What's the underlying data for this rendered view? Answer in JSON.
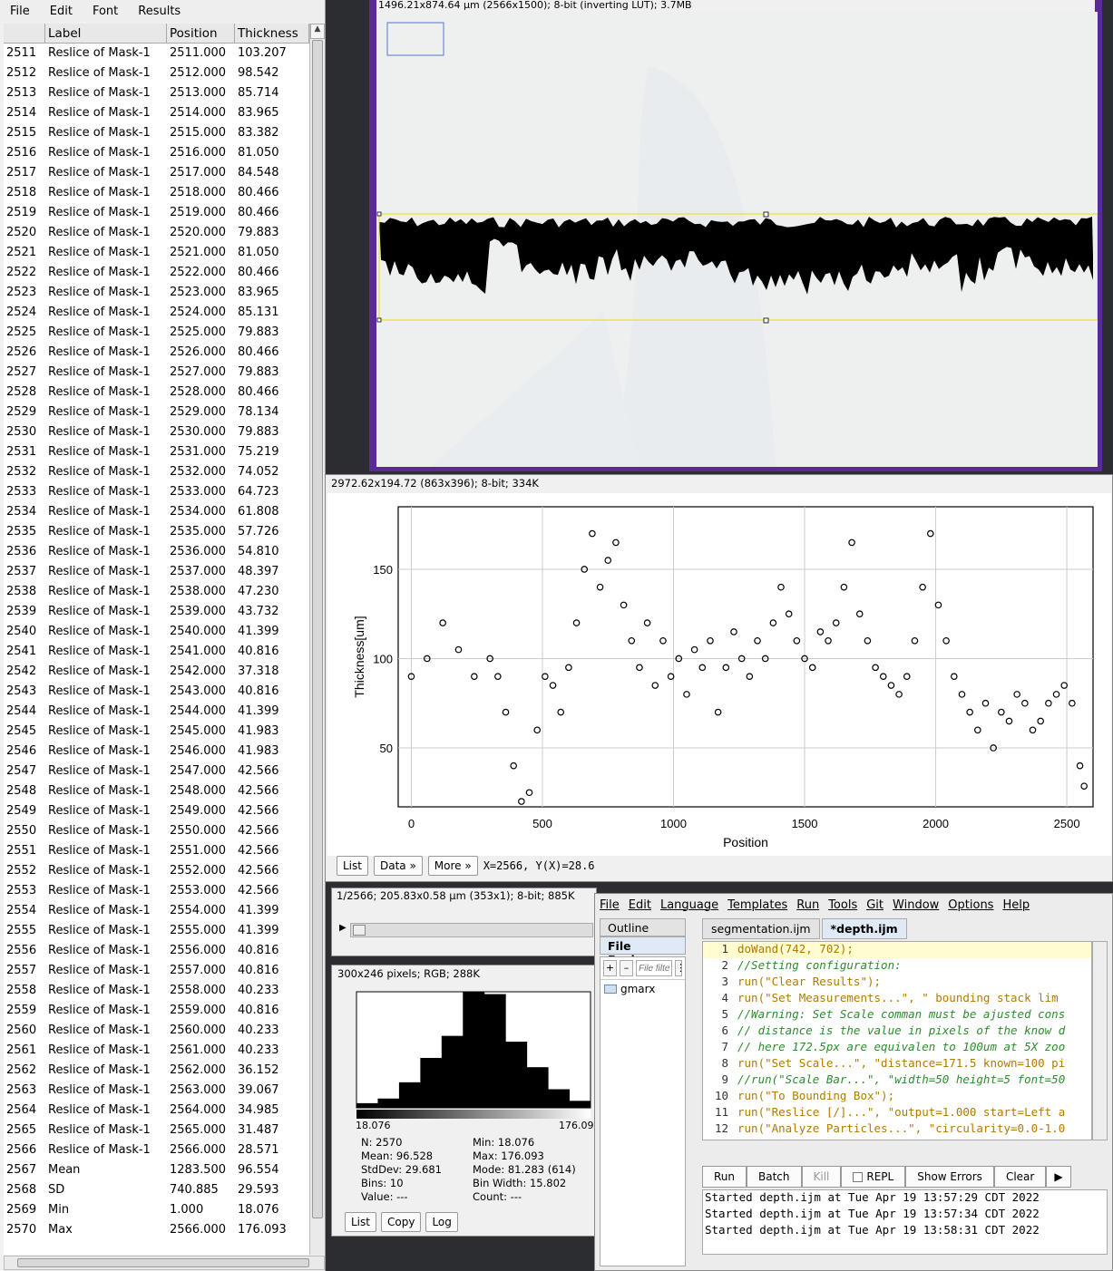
{
  "results": {
    "menu": [
      "File",
      "Edit",
      "Font",
      "Results"
    ],
    "columns": [
      "",
      "Label",
      "Position",
      "Thickness"
    ],
    "rows": [
      [
        "2511",
        "Reslice of Mask-1",
        "2511.000",
        "103.207"
      ],
      [
        "2512",
        "Reslice of Mask-1",
        "2512.000",
        "98.542"
      ],
      [
        "2513",
        "Reslice of Mask-1",
        "2513.000",
        "85.714"
      ],
      [
        "2514",
        "Reslice of Mask-1",
        "2514.000",
        "83.965"
      ],
      [
        "2515",
        "Reslice of Mask-1",
        "2515.000",
        "83.382"
      ],
      [
        "2516",
        "Reslice of Mask-1",
        "2516.000",
        "81.050"
      ],
      [
        "2517",
        "Reslice of Mask-1",
        "2517.000",
        "84.548"
      ],
      [
        "2518",
        "Reslice of Mask-1",
        "2518.000",
        "80.466"
      ],
      [
        "2519",
        "Reslice of Mask-1",
        "2519.000",
        "80.466"
      ],
      [
        "2520",
        "Reslice of Mask-1",
        "2520.000",
        "79.883"
      ],
      [
        "2521",
        "Reslice of Mask-1",
        "2521.000",
        "81.050"
      ],
      [
        "2522",
        "Reslice of Mask-1",
        "2522.000",
        "80.466"
      ],
      [
        "2523",
        "Reslice of Mask-1",
        "2523.000",
        "83.965"
      ],
      [
        "2524",
        "Reslice of Mask-1",
        "2524.000",
        "85.131"
      ],
      [
        "2525",
        "Reslice of Mask-1",
        "2525.000",
        "79.883"
      ],
      [
        "2526",
        "Reslice of Mask-1",
        "2526.000",
        "80.466"
      ],
      [
        "2527",
        "Reslice of Mask-1",
        "2527.000",
        "79.883"
      ],
      [
        "2528",
        "Reslice of Mask-1",
        "2528.000",
        "80.466"
      ],
      [
        "2529",
        "Reslice of Mask-1",
        "2529.000",
        "78.134"
      ],
      [
        "2530",
        "Reslice of Mask-1",
        "2530.000",
        "79.883"
      ],
      [
        "2531",
        "Reslice of Mask-1",
        "2531.000",
        "75.219"
      ],
      [
        "2532",
        "Reslice of Mask-1",
        "2532.000",
        "74.052"
      ],
      [
        "2533",
        "Reslice of Mask-1",
        "2533.000",
        "64.723"
      ],
      [
        "2534",
        "Reslice of Mask-1",
        "2534.000",
        "61.808"
      ],
      [
        "2535",
        "Reslice of Mask-1",
        "2535.000",
        "57.726"
      ],
      [
        "2536",
        "Reslice of Mask-1",
        "2536.000",
        "54.810"
      ],
      [
        "2537",
        "Reslice of Mask-1",
        "2537.000",
        "48.397"
      ],
      [
        "2538",
        "Reslice of Mask-1",
        "2538.000",
        "47.230"
      ],
      [
        "2539",
        "Reslice of Mask-1",
        "2539.000",
        "43.732"
      ],
      [
        "2540",
        "Reslice of Mask-1",
        "2540.000",
        "41.399"
      ],
      [
        "2541",
        "Reslice of Mask-1",
        "2541.000",
        "40.816"
      ],
      [
        "2542",
        "Reslice of Mask-1",
        "2542.000",
        "37.318"
      ],
      [
        "2543",
        "Reslice of Mask-1",
        "2543.000",
        "40.816"
      ],
      [
        "2544",
        "Reslice of Mask-1",
        "2544.000",
        "41.399"
      ],
      [
        "2545",
        "Reslice of Mask-1",
        "2545.000",
        "41.983"
      ],
      [
        "2546",
        "Reslice of Mask-1",
        "2546.000",
        "41.983"
      ],
      [
        "2547",
        "Reslice of Mask-1",
        "2547.000",
        "42.566"
      ],
      [
        "2548",
        "Reslice of Mask-1",
        "2548.000",
        "42.566"
      ],
      [
        "2549",
        "Reslice of Mask-1",
        "2549.000",
        "42.566"
      ],
      [
        "2550",
        "Reslice of Mask-1",
        "2550.000",
        "42.566"
      ],
      [
        "2551",
        "Reslice of Mask-1",
        "2551.000",
        "42.566"
      ],
      [
        "2552",
        "Reslice of Mask-1",
        "2552.000",
        "42.566"
      ],
      [
        "2553",
        "Reslice of Mask-1",
        "2553.000",
        "42.566"
      ],
      [
        "2554",
        "Reslice of Mask-1",
        "2554.000",
        "41.399"
      ],
      [
        "2555",
        "Reslice of Mask-1",
        "2555.000",
        "41.399"
      ],
      [
        "2556",
        "Reslice of Mask-1",
        "2556.000",
        "40.816"
      ],
      [
        "2557",
        "Reslice of Mask-1",
        "2557.000",
        "40.816"
      ],
      [
        "2558",
        "Reslice of Mask-1",
        "2558.000",
        "40.233"
      ],
      [
        "2559",
        "Reslice of Mask-1",
        "2559.000",
        "40.816"
      ],
      [
        "2560",
        "Reslice of Mask-1",
        "2560.000",
        "40.233"
      ],
      [
        "2561",
        "Reslice of Mask-1",
        "2561.000",
        "40.233"
      ],
      [
        "2562",
        "Reslice of Mask-1",
        "2562.000",
        "36.152"
      ],
      [
        "2563",
        "Reslice of Mask-1",
        "2563.000",
        "39.067"
      ],
      [
        "2564",
        "Reslice of Mask-1",
        "2564.000",
        "34.985"
      ],
      [
        "2565",
        "Reslice of Mask-1",
        "2565.000",
        "31.487"
      ],
      [
        "2566",
        "Reslice of Mask-1",
        "2566.000",
        "28.571"
      ],
      [
        "2567",
        "Mean",
        "1283.500",
        "96.554"
      ],
      [
        "2568",
        "SD",
        "740.885",
        "29.593"
      ],
      [
        "2569",
        "Min",
        "1.000",
        "18.076"
      ],
      [
        "2570",
        "Max",
        "2566.000",
        "176.093"
      ]
    ]
  },
  "mask_window": {
    "info": "1496.21x874.64 µm (2566x1500); 8-bit (inverting LUT); 3.7MB",
    "border_color": "#5b2a9a"
  },
  "plot_window": {
    "info": "2972.62x194.72  (863x396); 8-bit; 334K",
    "buttons": [
      "List",
      "Data »",
      "More »"
    ],
    "coords": "X=2566, Y(X)=28.6"
  },
  "chart_data": {
    "type": "scatter",
    "xlabel": "Position",
    "ylabel": "Thickness[um]",
    "xlim": [
      -50,
      2600
    ],
    "ylim": [
      17,
      185
    ],
    "xticks": [
      0,
      500,
      1000,
      1500,
      2000,
      2500
    ],
    "yticks": [
      50,
      100,
      150
    ],
    "grid": true,
    "marker": "open-circle",
    "x": [
      0,
      60,
      120,
      180,
      240,
      300,
      330,
      360,
      390,
      420,
      450,
      480,
      510,
      540,
      570,
      600,
      630,
      660,
      690,
      720,
      750,
      780,
      810,
      840,
      870,
      900,
      930,
      960,
      990,
      1020,
      1050,
      1080,
      1110,
      1140,
      1170,
      1200,
      1230,
      1260,
      1290,
      1320,
      1350,
      1380,
      1410,
      1440,
      1470,
      1500,
      1530,
      1560,
      1590,
      1620,
      1650,
      1680,
      1710,
      1740,
      1770,
      1800,
      1830,
      1860,
      1890,
      1920,
      1950,
      1980,
      2010,
      2040,
      2070,
      2100,
      2130,
      2160,
      2190,
      2220,
      2250,
      2280,
      2310,
      2340,
      2370,
      2400,
      2430,
      2460,
      2490,
      2520,
      2550,
      2566
    ],
    "y": [
      90,
      100,
      120,
      105,
      90,
      100,
      90,
      70,
      40,
      20,
      25,
      60,
      90,
      85,
      70,
      95,
      120,
      150,
      170,
      140,
      155,
      165,
      130,
      110,
      95,
      120,
      85,
      110,
      90,
      100,
      80,
      105,
      95,
      110,
      70,
      95,
      115,
      100,
      90,
      110,
      100,
      120,
      140,
      125,
      110,
      100,
      95,
      115,
      110,
      120,
      140,
      165,
      125,
      110,
      95,
      90,
      85,
      80,
      90,
      110,
      140,
      170,
      130,
      110,
      90,
      80,
      70,
      60,
      75,
      50,
      70,
      65,
      80,
      75,
      60,
      65,
      75,
      80,
      85,
      75,
      40,
      28.6
    ]
  },
  "reslice_window": {
    "info": "1/2566; 205.83x0.58 µm (353x1); 8-bit; 885K"
  },
  "histogram_window": {
    "info": "300x246 pixels; RGB; 288K",
    "bins_heights": [
      0.04,
      0.08,
      0.22,
      0.43,
      0.62,
      1.0,
      0.98,
      0.57,
      0.35,
      0.16,
      0.06
    ],
    "min_label": "18.076",
    "max_label": "176.09",
    "stats_left": [
      "N: 2570",
      "Mean: 96.528",
      "StdDev: 29.681",
      "Bins: 10",
      "Value: ---"
    ],
    "stats_right": [
      "Min: 18.076",
      "Max: 176.093",
      "Mode: 81.283 (614)",
      "Bin Width: 15.802",
      "Count: ---"
    ],
    "buttons": [
      "List",
      "Copy",
      "Log"
    ]
  },
  "editor": {
    "menu": [
      "File",
      "Edit",
      "Language",
      "Templates",
      "Run",
      "Tools",
      "Git",
      "Window",
      "Options",
      "Help"
    ],
    "side_tabs": [
      "Outline",
      "File Explorer"
    ],
    "file_filter_placeholder": "File filter",
    "tree_item": "gmarx",
    "tabs": [
      "segmentation.ijm",
      "*depth.ijm"
    ],
    "lines": [
      "doWand(742, 702);",
      "//Setting configuration:",
      "run(\"Clear Results\");",
      "run(\"Set Measurements...\", \"  bounding stack lim",
      "//Warning: Set Scale comman must be ajusted cons",
      "// distance is the value in pixels of the know d",
      "// here 172.5px are equivalen to 100um at 5X zoo",
      "run(\"Set Scale...\", \"distance=171.5 known=100 pi",
      "//run(\"Scale Bar...\", \"width=50 height=5 font=50",
      "run(\"To Bounding Box\");",
      "run(\"Reslice [/]...\", \"output=1.000 start=Left a",
      "run(\"Analyze Particles...\", \"circularity=0.0-1.0"
    ],
    "buttons": [
      "Run",
      "Batch",
      "Kill",
      "REPL",
      "Show Errors",
      "Clear"
    ],
    "console": [
      "Started depth.ijm at Tue Apr 19 13:57:29 CDT 2022",
      "Started depth.ijm at Tue Apr 19 13:57:34 CDT 2022",
      "Started depth.ijm at Tue Apr 19 13:58:31 CDT 2022"
    ]
  }
}
